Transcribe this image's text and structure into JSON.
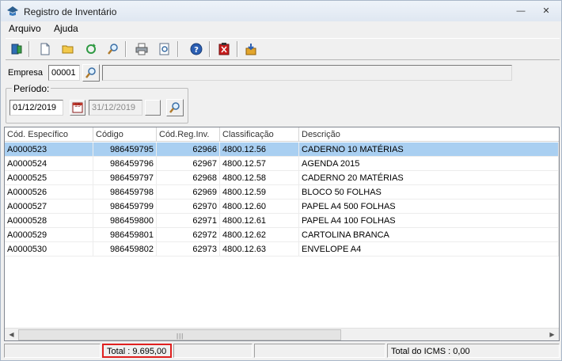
{
  "window": {
    "title": "Registro de Inventário",
    "minimize": "—",
    "close": "✕"
  },
  "menu": [
    "Arquivo",
    "Ajuda"
  ],
  "toolbar": [
    "exit-icon",
    "new-document-icon",
    "open-folder-icon",
    "refresh-icon",
    "search-icon",
    "printer-icon",
    "print-preview-icon",
    "help-icon",
    "delete-icon",
    "export-icon"
  ],
  "filters": {
    "empresa_label": "Empresa",
    "empresa_code": "00001",
    "empresa_name": "",
    "periodo_label": "Período:",
    "date_from": "01/12/2019",
    "calendar_label": "15",
    "date_to": "31/12/2019"
  },
  "grid": {
    "columns": [
      "Cód. Específico",
      "Código",
      "Cód.Reg.Inv.",
      "Classificação",
      "Descrição"
    ],
    "rows": [
      [
        "A0000523",
        "986459795",
        "62966",
        "4800.12.56",
        "CADERNO 10 MATÉRIAS"
      ],
      [
        "A0000524",
        "986459796",
        "62967",
        "4800.12.57",
        "AGENDA 2015"
      ],
      [
        "A0000525",
        "986459797",
        "62968",
        "4800.12.58",
        "CADERNO 20 MATÉRIAS"
      ],
      [
        "A0000526",
        "986459798",
        "62969",
        "4800.12.59",
        "BLOCO 50 FOLHAS"
      ],
      [
        "A0000527",
        "986459799",
        "62970",
        "4800.12.60",
        "PAPEL A4 500 FOLHAS"
      ],
      [
        "A0000528",
        "986459800",
        "62971",
        "4800.12.61",
        "PAPEL A4 100 FOLHAS"
      ],
      [
        "A0000529",
        "986459801",
        "62972",
        "4800.12.62",
        "CARTOLINA BRANCA"
      ],
      [
        "A0000530",
        "986459802",
        "62973",
        "4800.12.63",
        "ENVELOPE A4"
      ]
    ],
    "selected_row": 0
  },
  "status": {
    "total": "Total : 9.695,00",
    "total_icms": "Total do ICMS : 0,00"
  },
  "colors": {
    "selection": "#a9cff1",
    "highlight_border": "#e0201f"
  }
}
